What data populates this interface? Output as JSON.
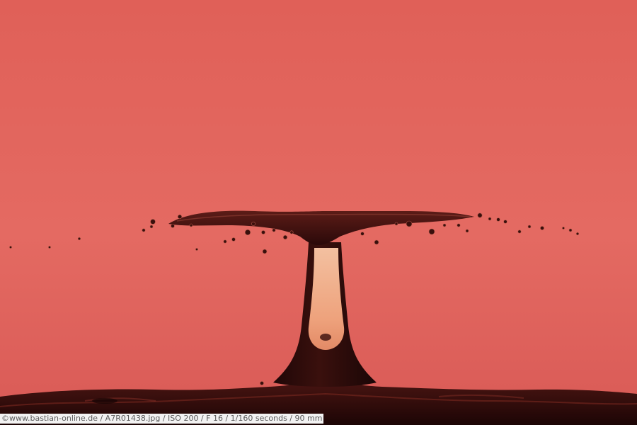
{
  "photo": {
    "subject": "water drop splash",
    "colors": {
      "background": "#e0625c",
      "background_light": "#e56d66",
      "liquid_dark": "#2a0c0c",
      "liquid_mid": "#5a1a16",
      "highlight": "#f0b08c"
    }
  },
  "caption": {
    "text": "©www.bastian-online.de / A7R01438.jpg / ISO 200 / F 16 / 1/160 seconds  / 90 mm"
  }
}
